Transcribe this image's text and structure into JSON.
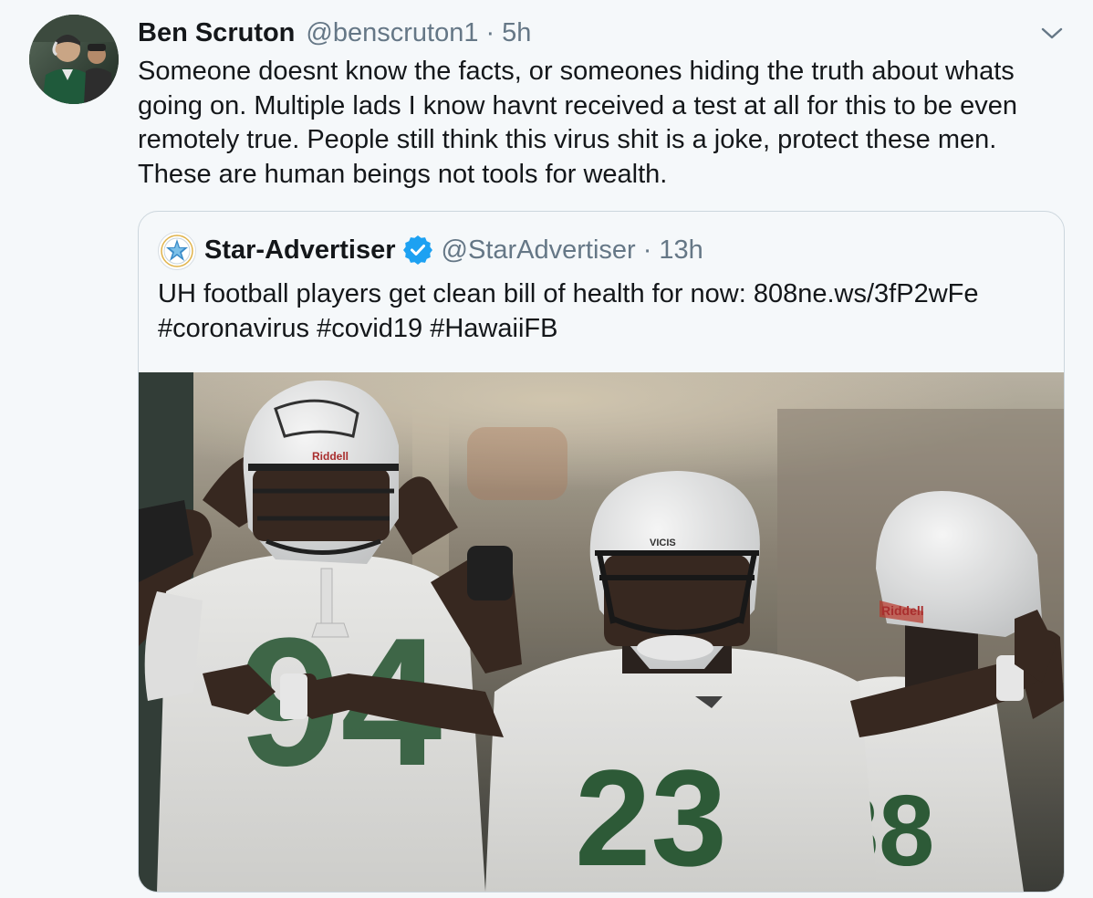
{
  "tweet": {
    "author_name": "Ben Scruton",
    "author_handle": "@benscruton1",
    "separator": "·",
    "time": "5h",
    "text": "Someone doesnt know the facts, or someones hiding the truth about whats going on. Multiple lads I know havnt received a test at all for this to be even remotely true. People still think this virus shit is a joke, protect these men. These are human beings not tools for wealth.",
    "avatar_icon": "profile-photo",
    "menu_icon": "chevron-down-icon"
  },
  "quoted_tweet": {
    "author_name": "Star-Advertiser",
    "verified_icon": "verified-badge-icon",
    "author_handle": "@StarAdvertiser",
    "separator": "·",
    "time": "13h",
    "text_line1": "UH football players get clean bill of health for now: 808ne.ws/3fP2wFe",
    "text_line2": "#coronavirus #covid19 #HawaiiFB",
    "photo": {
      "helmet_brand_1": "Riddell",
      "helmet_brand_2": "VICIS",
      "helmet_brand_3": "Riddell",
      "jersey_numbers": [
        "94",
        "23",
        "88"
      ]
    }
  },
  "colors": {
    "background": "#f5f8fa",
    "text": "#14171a",
    "secondary_text": "#657786",
    "verified_blue": "#1da1f2",
    "border": "#ccd6dd",
    "jersey_green": "#2f5e3a"
  }
}
